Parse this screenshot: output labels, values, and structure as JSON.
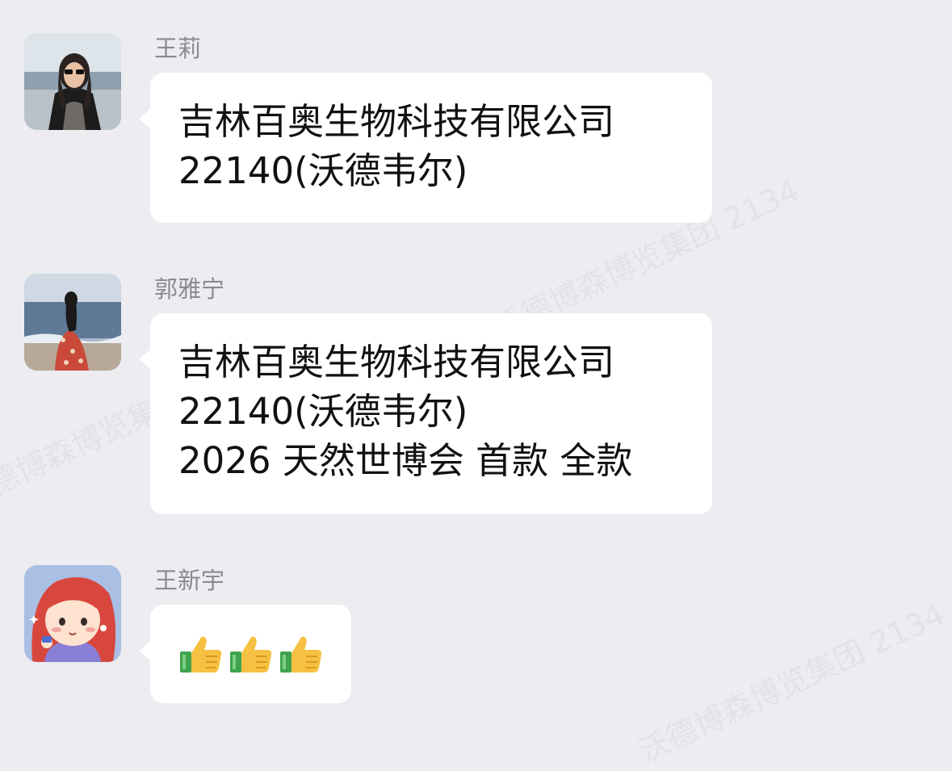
{
  "watermark_text": "沃德博森博览集团 2134",
  "messages": [
    {
      "sender": "王莉",
      "avatar_icon": "photo-avatar-woman-sunglasses",
      "lines": [
        "吉林百奥生物科技有限公司",
        "22140(沃德韦尔)"
      ]
    },
    {
      "sender": "郭雅宁",
      "avatar_icon": "photo-avatar-woman-beach",
      "lines": [
        "吉林百奥生物科技有限公司",
        "22140(沃德韦尔)",
        "2026 天然世博会 首款 全款"
      ]
    },
    {
      "sender": "王新宇",
      "avatar_icon": "cartoon-avatar-red-hair-girl",
      "emojis": [
        "thumbs-up-icon",
        "thumbs-up-icon",
        "thumbs-up-icon"
      ]
    }
  ],
  "colors": {
    "background": "#ececf1",
    "bubble": "#ffffff",
    "sender_name": "#8a8a8f",
    "message_text": "#111111"
  }
}
